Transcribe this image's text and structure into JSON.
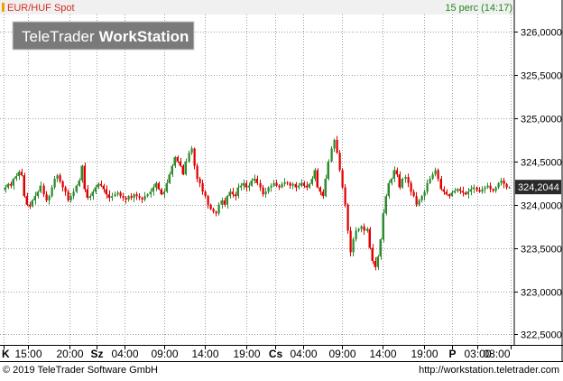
{
  "header": {
    "symbol_label": "EUR/HUF Spot",
    "interval_label": "15 perc (14:17)"
  },
  "watermark": {
    "part1": "TeleTrader",
    "part2": "WorkStation"
  },
  "footer": {
    "copyright": "© 2019 TeleTrader Software GmbH",
    "url": "http://workstation.teletrader.com"
  },
  "colors": {
    "up": "#2e8b2e",
    "down": "#e00000",
    "grid": "#9aa0a6",
    "header_bg": "#f0f0f0",
    "header_text": "#d03020",
    "interval_text": "#1d8a1d",
    "watermark_bg": "#7a7a7a",
    "price_box_bg": "#2a2a2a"
  },
  "chart_data": {
    "type": "candlestick",
    "title": "EUR/HUF Spot",
    "interval": "15 perc (14:17)",
    "last_price": 324.2044,
    "last_price_label": "324,2044",
    "ylim": [
      322.4,
      326.2
    ],
    "y_ticks": [
      322.5,
      323.0,
      323.5,
      324.0,
      324.5,
      325.0,
      325.5,
      326.0
    ],
    "y_tick_labels": [
      "322,5000",
      "323,0000",
      "323,5000",
      "324,0000",
      "324,5000",
      "325,0000",
      "325,5000",
      "326,0000"
    ],
    "x_tick_labels": [
      {
        "label": "K",
        "bold": true,
        "frac": 0.0
      },
      {
        "label": "15:00",
        "bold": false,
        "frac": 0.048
      },
      {
        "label": "20:00",
        "bold": false,
        "frac": 0.13
      },
      {
        "label": "Sz",
        "bold": true,
        "frac": 0.183
      },
      {
        "label": "04:00",
        "bold": false,
        "frac": 0.239
      },
      {
        "label": "09:00",
        "bold": false,
        "frac": 0.316
      },
      {
        "label": "14:00",
        "bold": false,
        "frac": 0.397
      },
      {
        "label": "19:00",
        "bold": false,
        "frac": 0.478
      },
      {
        "label": "Cs",
        "bold": true,
        "frac": 0.535
      },
      {
        "label": "04:00",
        "bold": false,
        "frac": 0.591
      },
      {
        "label": "09:00",
        "bold": false,
        "frac": 0.668
      },
      {
        "label": "14:00",
        "bold": false,
        "frac": 0.747
      },
      {
        "label": "19:00",
        "bold": false,
        "frac": 0.83
      },
      {
        "label": "P",
        "bold": true,
        "frac": 0.885
      },
      {
        "label": "03:00",
        "bold": false,
        "frac": 0.935
      },
      {
        "label": "08:00",
        "bold": false,
        "frac": 1.0
      }
    ],
    "path": [
      324.17,
      324.2,
      324.24,
      324.22,
      324.3,
      324.33,
      324.38,
      324.34,
      324.1,
      324.0,
      323.98,
      324.05,
      324.1,
      324.15,
      324.22,
      324.12,
      324.05,
      324.1,
      324.2,
      324.3,
      324.34,
      324.27,
      324.2,
      324.15,
      324.05,
      324.1,
      324.15,
      324.22,
      324.28,
      324.45,
      324.18,
      324.08,
      324.1,
      324.15,
      324.2,
      324.24,
      324.22,
      324.18,
      324.12,
      324.08,
      324.1,
      324.12,
      324.14,
      324.1,
      324.08,
      324.06,
      324.1,
      324.08,
      324.12,
      324.1,
      324.08,
      324.06,
      324.1,
      324.12,
      324.15,
      324.2,
      324.25,
      324.18,
      324.12,
      324.15,
      324.25,
      324.35,
      324.45,
      324.55,
      324.5,
      324.45,
      324.35,
      324.5,
      324.6,
      324.65,
      324.45,
      324.3,
      324.25,
      324.15,
      324.1,
      324.0,
      323.95,
      323.92,
      323.9,
      324.0,
      324.05,
      324.0,
      324.1,
      324.15,
      324.12,
      324.1,
      324.2,
      324.22,
      324.25,
      324.2,
      324.22,
      324.28,
      324.3,
      324.25,
      324.2,
      324.12,
      324.15,
      324.2,
      324.22,
      324.25,
      324.22,
      324.2,
      324.24,
      324.26,
      324.25,
      324.22,
      324.24,
      324.2,
      324.22,
      324.25,
      324.22,
      324.2,
      324.24,
      324.3,
      324.4,
      324.2,
      324.15,
      324.1,
      324.3,
      324.5,
      324.65,
      324.75,
      324.6,
      324.4,
      324.2,
      324.0,
      323.7,
      323.45,
      323.6,
      323.7,
      323.72,
      323.75,
      323.7,
      323.72,
      323.5,
      323.35,
      323.28,
      323.4,
      323.6,
      323.9,
      324.1,
      324.25,
      324.3,
      324.4,
      324.35,
      324.2,
      324.3,
      324.32,
      324.25,
      324.15,
      324.1,
      324.0,
      324.05,
      324.1,
      324.15,
      324.25,
      324.3,
      324.35,
      324.4,
      324.3,
      324.18,
      324.15,
      324.12,
      324.1,
      324.14,
      324.16,
      324.18,
      324.16,
      324.14,
      324.12,
      324.15,
      324.18,
      324.2,
      324.17,
      324.15,
      324.18,
      324.2,
      324.22,
      324.18,
      324.16,
      324.2,
      324.25,
      324.28,
      324.24,
      324.2,
      324.2
    ]
  }
}
